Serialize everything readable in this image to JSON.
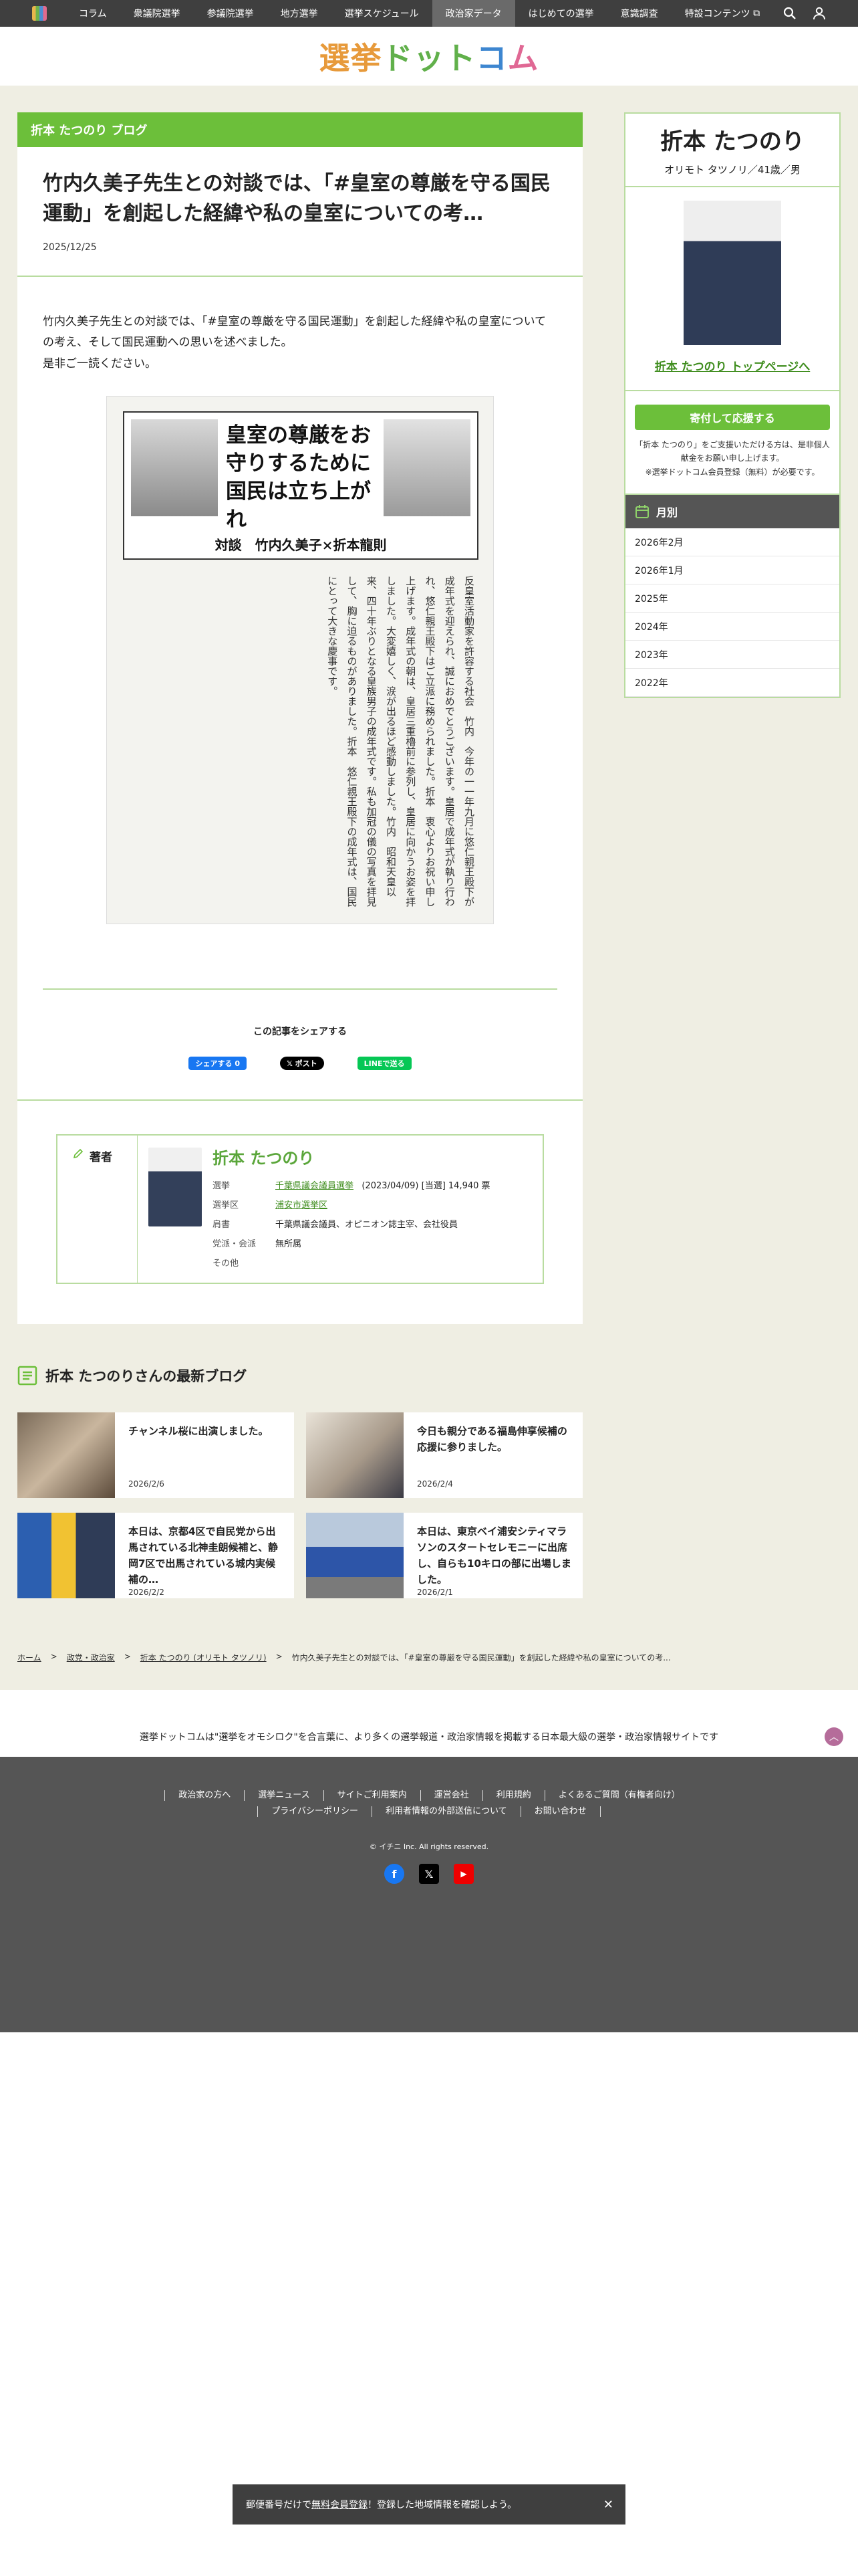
{
  "nav": {
    "items": [
      "コラム",
      "衆議院選挙",
      "参議院選挙",
      "地方選挙",
      "選挙スケジュール",
      "政治家データ",
      "はじめての選挙",
      "意識調査",
      "特設コンテンツ"
    ],
    "active": "政治家データ"
  },
  "logo": {
    "part1": "選挙",
    "part2": "ドット",
    "part3": "コ",
    "part4": "ム"
  },
  "article": {
    "category": "折本 たつのり ブログ",
    "title": "竹内久美子先生との対談では、「#皇室の尊厳を守る国民運動」を創起した経緯や私の皇室についての考…",
    "date": "2025/12/25",
    "body1": "竹内久美子先生との対談では、「#皇室の尊厳を守る国民運動」を創起した経緯や私の皇室についての考え、そして国民運動への思いを述べました。",
    "body2": "是非ご一読ください。",
    "clipping": {
      "headline": "皇室の尊厳をお守りするために国民は立ち上がれ",
      "subtitle": "対談　竹内久美子×折本龍則",
      "body": "反皇室活動家を許容する社会　竹内　今年の一一年九月に悠仁親王殿下が成年式を迎えられ、誠におめでとうございます。皇居で成年式が執り行われ、悠仁親王殿下はご立派に務められました。折本　衷心よりお祝い申し上げます。成年式の朝は、皇居三重櫓前に参列し、皇居に向かうお姿を拝しました。大変嬉しく、涙が出るほど感動しました。竹内　昭和天皇以来、四十年ぶりとなる皇族男子の成年式です。私も加冠の儀の写真を拝見して、胸に迫るものがありました。折本　悠仁親王殿下の成年式は、国民にとって大きな慶事です。"
    }
  },
  "share": {
    "title": "この記事をシェアする",
    "facebook": "シェアする 0",
    "x": "𝕏 ポスト",
    "line": "LINEで送る"
  },
  "author": {
    "label": "著者",
    "name": "折本 たつのり",
    "rows": [
      {
        "k": "選挙",
        "v": "千葉県議会議員選挙",
        "extra": "(2023/04/09) [当選] 14,940 票"
      },
      {
        "k": "選挙区",
        "v": "浦安市選挙区",
        "extra": ""
      },
      {
        "k": "肩書",
        "v": "千葉県議会議員、オピニオン誌主宰、会社役員",
        "extra": ""
      },
      {
        "k": "党派・会派",
        "v": "無所属",
        "extra": ""
      },
      {
        "k": "その他",
        "v": "",
        "extra": ""
      }
    ]
  },
  "profile": {
    "name": "折本 たつのり",
    "kana": "オリモト タツノリ／41歳／男",
    "top_link": "折本 たつのり トップページへ",
    "donate_btn": "寄付して応援する",
    "donate_note1": "「折本 たつのり」をご支援いただける方は、是非個人",
    "donate_note2": "献金をお願い申し上げます。",
    "donate_note3": "※選挙ドットコム会員登録（無料）が必要です。"
  },
  "monthly": {
    "title": "月別",
    "items": [
      "2026年2月",
      "2026年1月",
      "2025年",
      "2024年",
      "2023年",
      "2022年"
    ]
  },
  "latest": {
    "title": "折本 たつのりさんの最新ブログ",
    "posts": [
      {
        "title": "チャンネル桜に出演しました。",
        "date": "2026/2/6"
      },
      {
        "title": "今日も親分である福島伸享候補の応援に参りました。",
        "date": "2026/2/4"
      },
      {
        "title": "本日は、京都4区で自民党から出馬されている北神圭朗候補と、静岡7区で出馬されている城内実候補の…",
        "date": "2026/2/2"
      },
      {
        "title": "本日は、東京ベイ浦安シティマラソンのスタートセレモニーに出席し、自らも10キロの部に出場しました。",
        "date": "2026/2/1"
      }
    ]
  },
  "breadcrumbs": {
    "home": "ホーム",
    "party": "政党・政治家",
    "person": "折本 たつのり (オリモト タツノリ)",
    "current": "竹内久美子先生との対談では、「#皇室の尊厳を守る国民運動」を創起した経緯や私の皇室についての考..."
  },
  "tagline": "選挙ドットコムは\"選挙をオモシロク\"を合言葉に、より多くの選挙報道・政治家情報を掲載する日本最大級の選挙・政治家情報サイトです",
  "footer": {
    "links": [
      "政治家の方へ",
      "選挙ニュース",
      "サイトご利用案内",
      "運営会社",
      "利用規約",
      "よくあるご質問（有権者向け）",
      "プライバシーポリシー",
      "利用者情報の外部送信について",
      "お問い合わせ"
    ],
    "copyright": "© イチニ Inc. All rights reserved."
  },
  "bottom_bar": {
    "pre": "郵便番号だけで",
    "link": "無料会員登録",
    "post": "！登録した地域情報を確認しよう。"
  },
  "colors": {
    "accent_green": "#6cbf3a",
    "nav_bg": "#3f3f3f",
    "page_bg": "#efeee3"
  }
}
